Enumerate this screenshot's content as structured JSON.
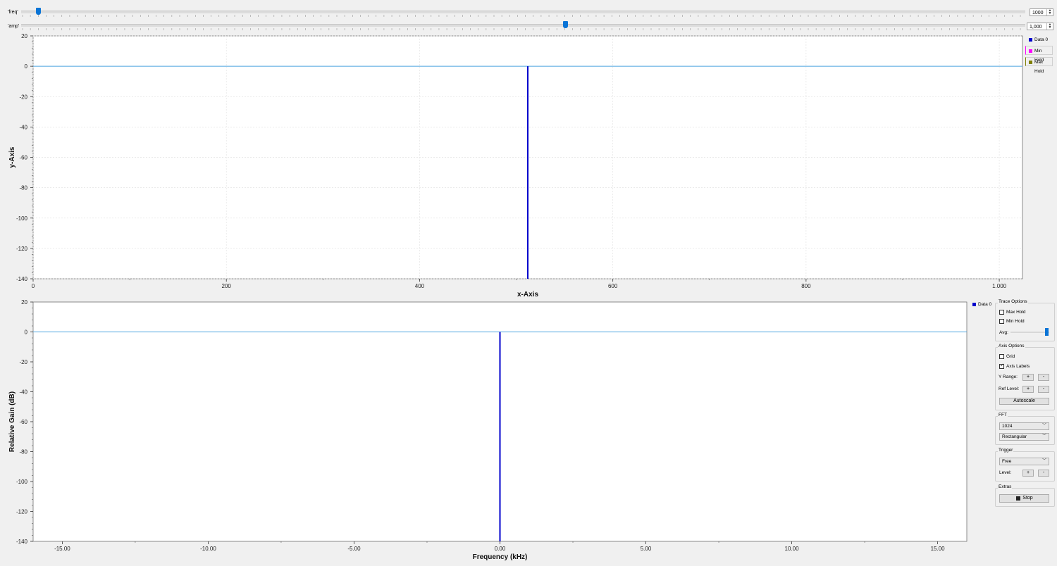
{
  "sliders": {
    "freq": {
      "label": "'freq'",
      "value": "1000",
      "fraction": 0.0
    },
    "amp": {
      "label": "'amp'",
      "value": "1,000",
      "fraction": 0.55
    }
  },
  "top_legend": [
    {
      "label": "Data 0",
      "color": "#0000cc"
    },
    {
      "label": "Min Hold",
      "color": "#ff00ff"
    },
    {
      "label": "Max Hold",
      "color": "#808000"
    }
  ],
  "bottom_legend": [
    {
      "label": "Data 0",
      "color": "#0000cc"
    }
  ],
  "controls": {
    "trace_options_title": "Trace Options",
    "max_hold": "Max Hold",
    "min_hold": "Min Hold",
    "avg": "Avg:",
    "axis_options_title": "Axis Options",
    "grid": "Grid",
    "axis_labels": "Axis Labels",
    "y_range": "Y Range:",
    "ref_level": "Ref Level:",
    "plus": "+",
    "minus": "-",
    "autoscale": "Autoscale",
    "fft_title": "FFT",
    "fft_size": "1024",
    "fft_window": "Rectangular",
    "trigger_title": "Trigger",
    "trigger_mode": "Free",
    "level": "Level:",
    "extras_title": "Extras",
    "stop": "Stop"
  },
  "chart_data": [
    {
      "type": "line",
      "xlabel": "x-Axis",
      "ylabel": "y-Axis",
      "xlim": [
        0,
        1024
      ],
      "ylim": [
        -140,
        20
      ],
      "xticks": [
        "0",
        "200",
        "400",
        "600",
        "800",
        "1.000"
      ],
      "xtick_values": [
        0,
        200,
        400,
        600,
        800,
        1000
      ],
      "yticks": [
        "20",
        "0",
        "-20",
        "-40",
        "-60",
        "-80",
        "-100",
        "-120",
        "-140"
      ],
      "ytick_values": [
        20,
        0,
        -20,
        -40,
        -60,
        -80,
        -100,
        -120,
        -140
      ],
      "grid": true,
      "legend": "right",
      "series": [
        {
          "name": "Data 0",
          "color": "#0000cc",
          "impulse_x": 512,
          "impulse_top": 0,
          "baseline": -140
        }
      ],
      "reference_line": 0
    },
    {
      "type": "line",
      "xlabel": "Frequency (kHz)",
      "ylabel": "Relative Gain (dB)",
      "xlim": [
        -16,
        16
      ],
      "ylim": [
        -140,
        20
      ],
      "xticks": [
        "-15.00",
        "-10.00",
        "-5.00",
        "0.00",
        "5.00",
        "10.00",
        "15.00"
      ],
      "xtick_values": [
        -15,
        -10,
        -5,
        0,
        5,
        10,
        15
      ],
      "yticks": [
        "20",
        "0",
        "-20",
        "-40",
        "-60",
        "-80",
        "-100",
        "-120",
        "-140"
      ],
      "ytick_values": [
        20,
        0,
        -20,
        -40,
        -60,
        -80,
        -100,
        -120,
        -140
      ],
      "grid": false,
      "legend": "top-right",
      "series": [
        {
          "name": "Data 0",
          "color": "#0000cc",
          "impulse_x": 0,
          "impulse_top": 0,
          "baseline": -140
        }
      ],
      "reference_line": 0
    }
  ]
}
